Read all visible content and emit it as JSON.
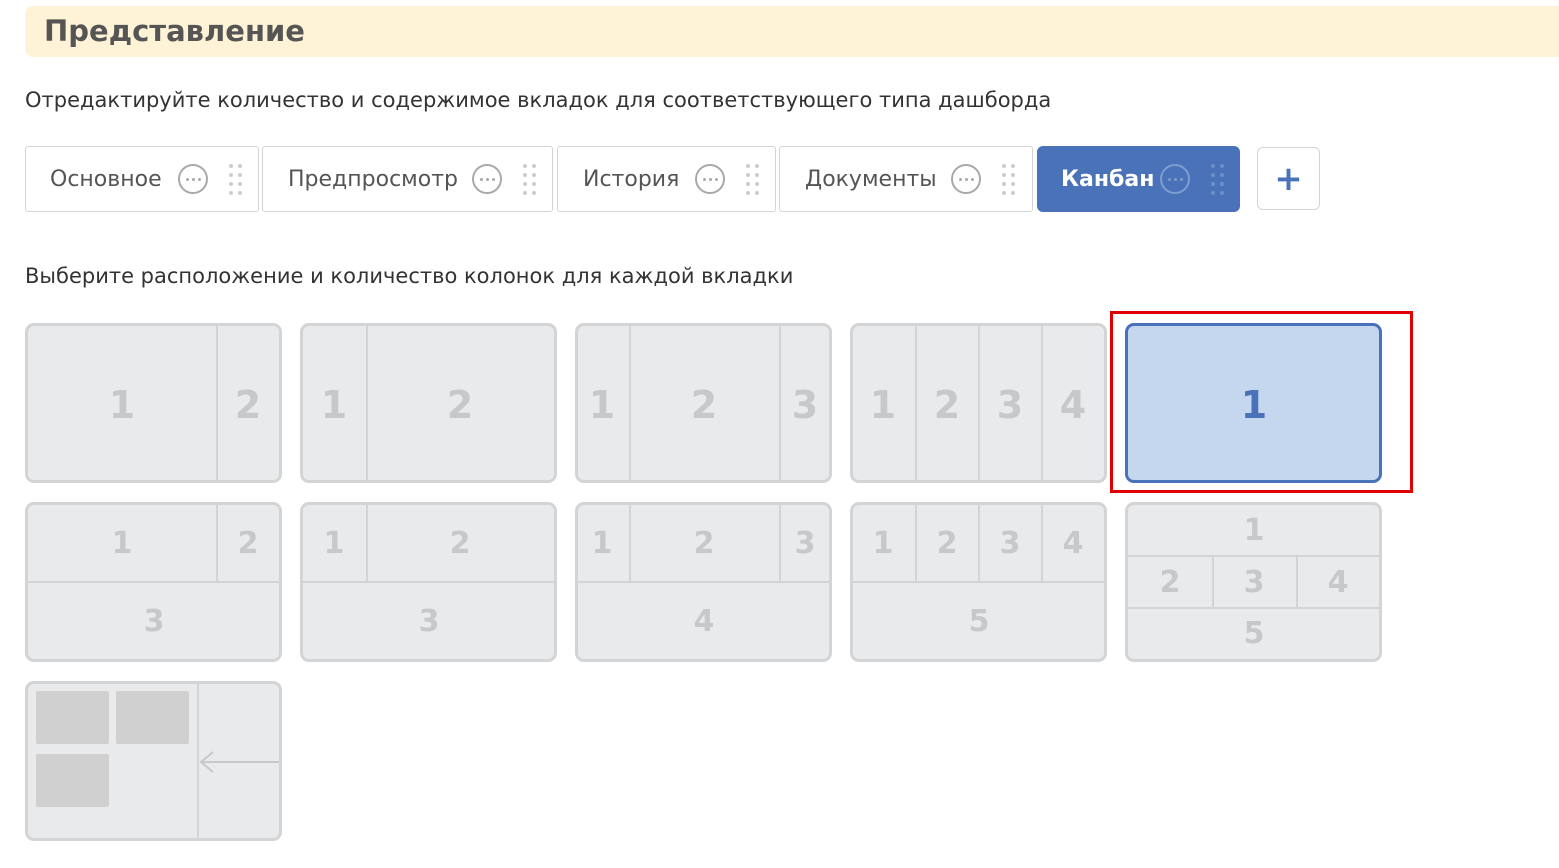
{
  "header": {
    "title": "Представление"
  },
  "tabs_description": "Отредактируйте количество и содержимое вкладок для соответствующего типа дашборда",
  "tabs": [
    {
      "label": "Основное",
      "active": false
    },
    {
      "label": "Предпросмотр",
      "active": false
    },
    {
      "label": "История",
      "active": false
    },
    {
      "label": "Документы",
      "active": false
    },
    {
      "label": "Канбан",
      "active": true
    }
  ],
  "add_tab": {
    "label": "+"
  },
  "layout_description": "Выберите расположение и количество колонок для каждой вкладки",
  "layouts": {
    "l1": [
      "1",
      "2"
    ],
    "l2": [
      "1",
      "2"
    ],
    "l3": [
      "1",
      "2",
      "3"
    ],
    "l4": [
      "1",
      "2",
      "3",
      "4"
    ],
    "l5": [
      "1"
    ],
    "l6": [
      "1",
      "2",
      "3"
    ],
    "l7": [
      "1",
      "2",
      "3"
    ],
    "l8": [
      "1",
      "2",
      "3",
      "4"
    ],
    "l9": [
      "1",
      "2",
      "3",
      "4",
      "5"
    ],
    "l10": [
      "1",
      "2",
      "3",
      "4",
      "5"
    ]
  },
  "selected_layout": "l5",
  "colors": {
    "accent": "#4a72b8",
    "highlight": "#e00000",
    "header_bg": "#fef3d6"
  },
  "icons": {
    "tab_menu": "more-dots-icon",
    "tab_drag": "drag-handle-icon",
    "add": "plus-icon",
    "arrow": "arrow-left-icon"
  }
}
